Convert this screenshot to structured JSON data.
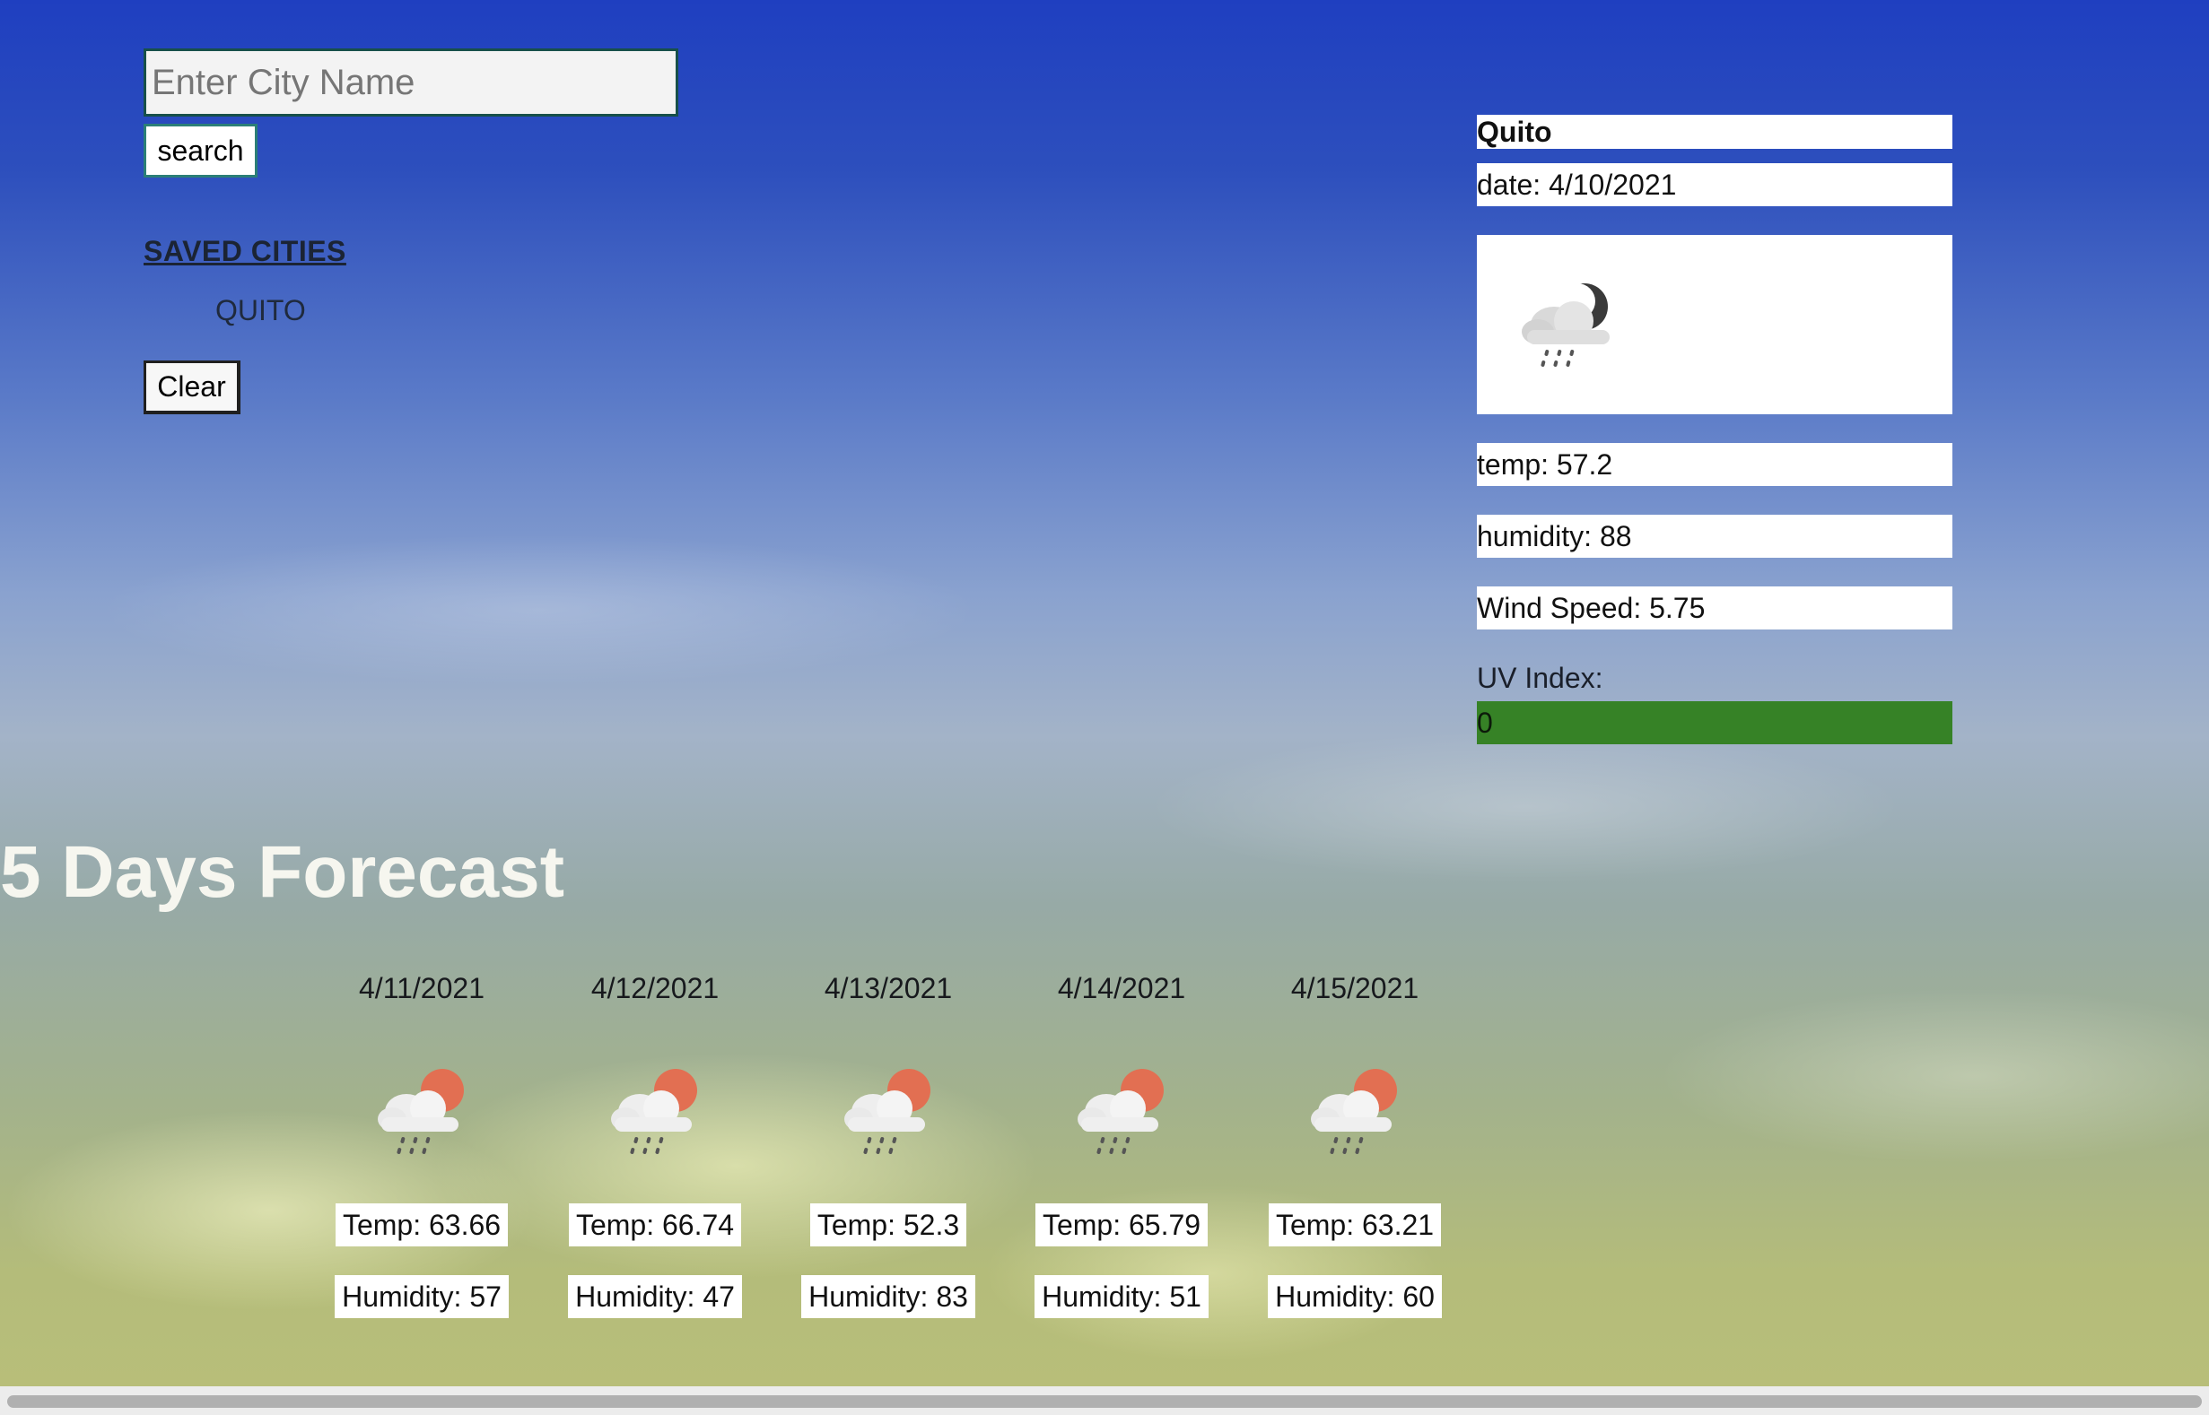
{
  "search": {
    "placeholder": "Enter City Name",
    "value": "",
    "button_label": "search"
  },
  "saved": {
    "title": "SAVED CITIES",
    "cities": [
      "QUITO"
    ],
    "clear_label": "Clear"
  },
  "current": {
    "city": "Quito",
    "date": "date: 4/10/2021",
    "icon": "night-rain-cloud-icon",
    "temp": "temp: 57.2",
    "humidity": "humidity: 88",
    "wind": "Wind Speed: 5.75",
    "uv_label": "UV Index:",
    "uv_value": "0",
    "uv_color": "#368226"
  },
  "forecast": {
    "title": "5 Days Forecast",
    "days": [
      {
        "date": "4/11/2021",
        "icon": "sun-rain-cloud-icon",
        "temp": "Temp: 63.66",
        "humidity": "Humidity: 57"
      },
      {
        "date": "4/12/2021",
        "icon": "sun-rain-cloud-icon",
        "temp": "Temp: 66.74",
        "humidity": "Humidity: 47"
      },
      {
        "date": "4/13/2021",
        "icon": "sun-rain-cloud-icon",
        "temp": "Temp: 52.3",
        "humidity": "Humidity: 83"
      },
      {
        "date": "4/14/2021",
        "icon": "sun-rain-cloud-icon",
        "temp": "Temp: 65.79",
        "humidity": "Humidity: 51"
      },
      {
        "date": "4/15/2021",
        "icon": "sun-rain-cloud-icon",
        "temp": "Temp: 63.21",
        "humidity": "Humidity: 60"
      }
    ]
  }
}
